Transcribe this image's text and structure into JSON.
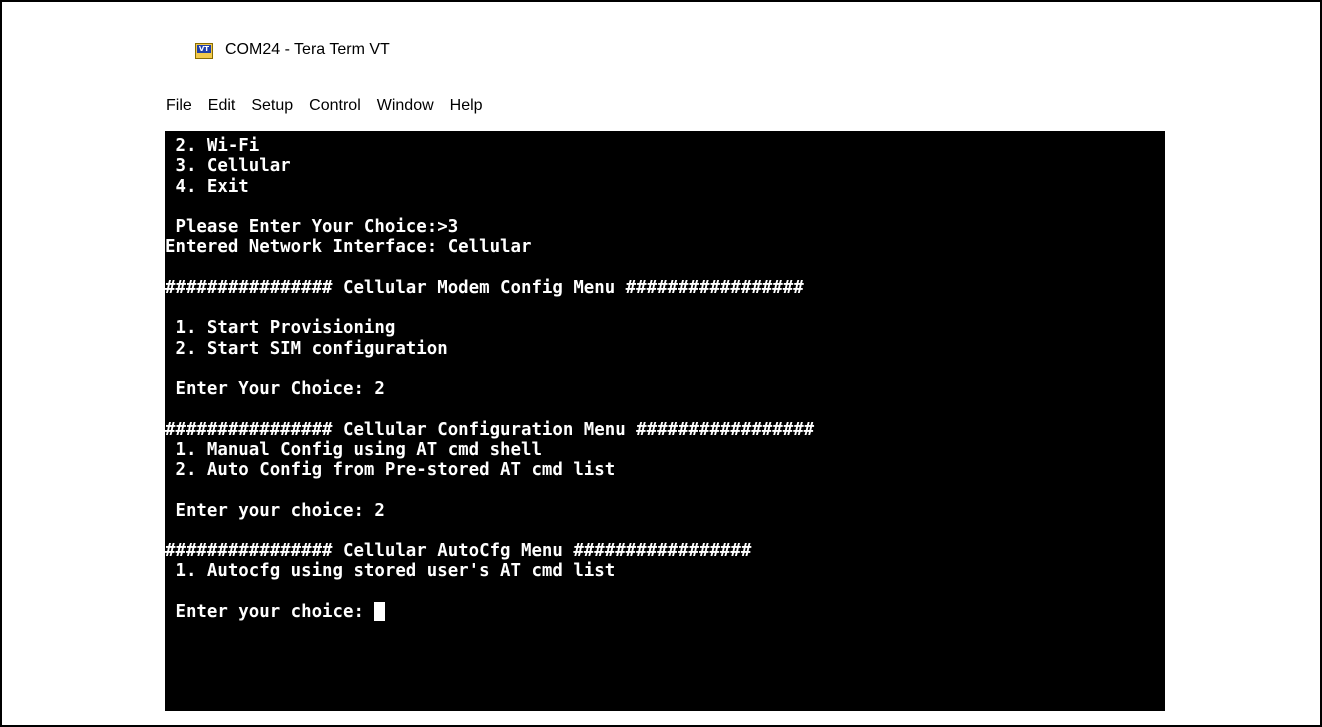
{
  "window": {
    "title": "COM24 - Tera Term VT",
    "icon": "tera-term-vt-icon",
    "icon_text": "VT"
  },
  "menu": [
    "File",
    "Edit",
    "Setup",
    "Control",
    "Window",
    "Help"
  ],
  "terminal": {
    "lines": [
      " 2. Wi-Fi",
      " 3. Cellular",
      " 4. Exit",
      "",
      " Please Enter Your Choice:>3",
      "Entered Network Interface: Cellular",
      "",
      "################ Cellular Modem Config Menu #################",
      "",
      " 1. Start Provisioning",
      " 2. Start SIM configuration",
      "",
      " Enter Your Choice: 2",
      "",
      "################ Cellular Configuration Menu #################",
      " 1. Manual Config using AT cmd shell",
      " 2. Auto Config from Pre-stored AT cmd list",
      "",
      " Enter your choice: 2",
      "",
      "################ Cellular AutoCfg Menu #################",
      " 1. Autocfg using stored user's AT cmd list",
      "",
      " Enter your choice: "
    ]
  }
}
